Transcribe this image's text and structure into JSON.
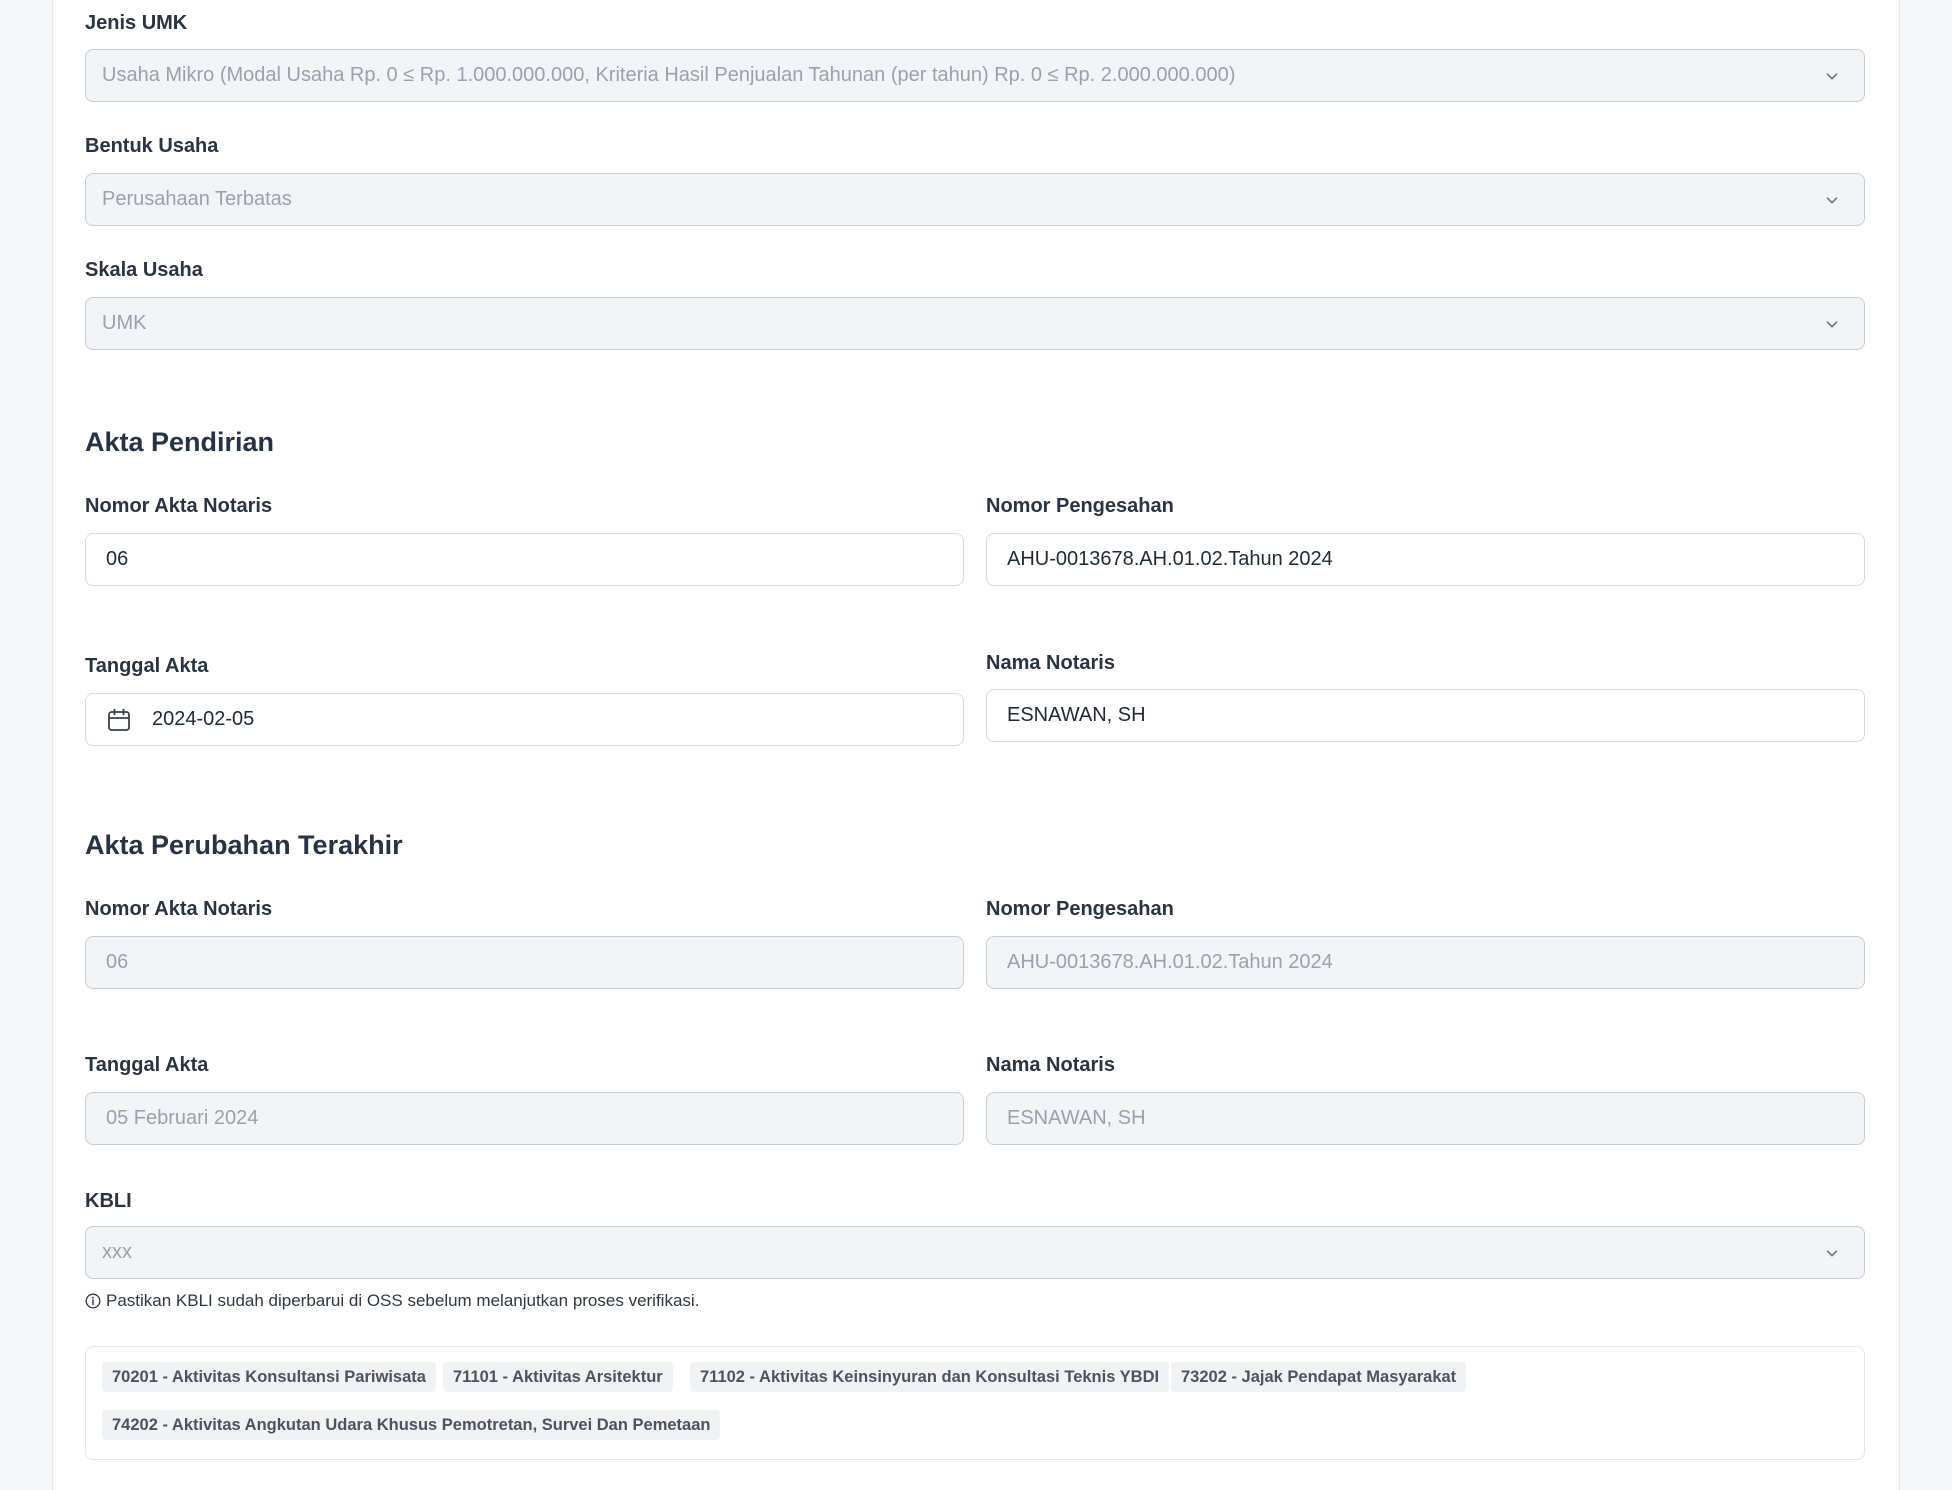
{
  "umk": {
    "jenis_label": "Jenis UMK",
    "jenis_value": "Usaha Mikro (Modal Usaha Rp. 0 ≤ Rp. 1.000.000.000, Kriteria Hasil Penjualan Tahunan (per tahun) Rp. 0 ≤ Rp. 2.000.000.000)",
    "bentuk_label": "Bentuk Usaha",
    "bentuk_value": "Perusahaan Terbatas",
    "skala_label": "Skala Usaha",
    "skala_value": "UMK"
  },
  "akta_pendirian": {
    "title": "Akta Pendirian",
    "nomor_akta_label": "Nomor Akta Notaris",
    "nomor_akta_value": "06",
    "nomor_pengesahan_label": "Nomor Pengesahan",
    "nomor_pengesahan_value": "AHU-0013678.AH.01.02.Tahun 2024",
    "tanggal_label": "Tanggal Akta",
    "tanggal_value": "2024-02-05",
    "nama_notaris_label": "Nama Notaris",
    "nama_notaris_value": "ESNAWAN, SH"
  },
  "akta_perubahan": {
    "title": "Akta Perubahan Terakhir",
    "nomor_akta_label": "Nomor Akta Notaris",
    "nomor_akta_value": "06",
    "nomor_pengesahan_label": "Nomor Pengesahan",
    "nomor_pengesahan_value": "AHU-0013678.AH.01.02.Tahun 2024",
    "tanggal_label": "Tanggal Akta",
    "tanggal_value": "05 Februari 2024",
    "nama_notaris_label": "Nama Notaris",
    "nama_notaris_value": "ESNAWAN, SH"
  },
  "kbli": {
    "label": "KBLI",
    "select_value": "xxx",
    "hint": "Pastikan KBLI sudah diperbarui di OSS sebelum melanjutkan proses verifikasi.",
    "tags": [
      "70201 - Aktivitas Konsultansi Pariwisata",
      "71101 - Aktivitas Arsitektur",
      "71102 - Aktivitas Keinsinyuran dan Konsultasi Teknis YBDI",
      "73202 - Jajak Pendapat Masyarakat",
      "74202 - Aktivitas Angkutan Udara Khusus Pemotretan, Survei Dan Pemetaan"
    ]
  },
  "icons": {
    "select_arrow": "chevron-down-icon",
    "date": "calendar-icon",
    "info": "info-circle-icon"
  },
  "colors": {
    "disabled_bg": "#f3f4f7",
    "tag_bg": "#f1f2f4",
    "heading": "#273244"
  }
}
